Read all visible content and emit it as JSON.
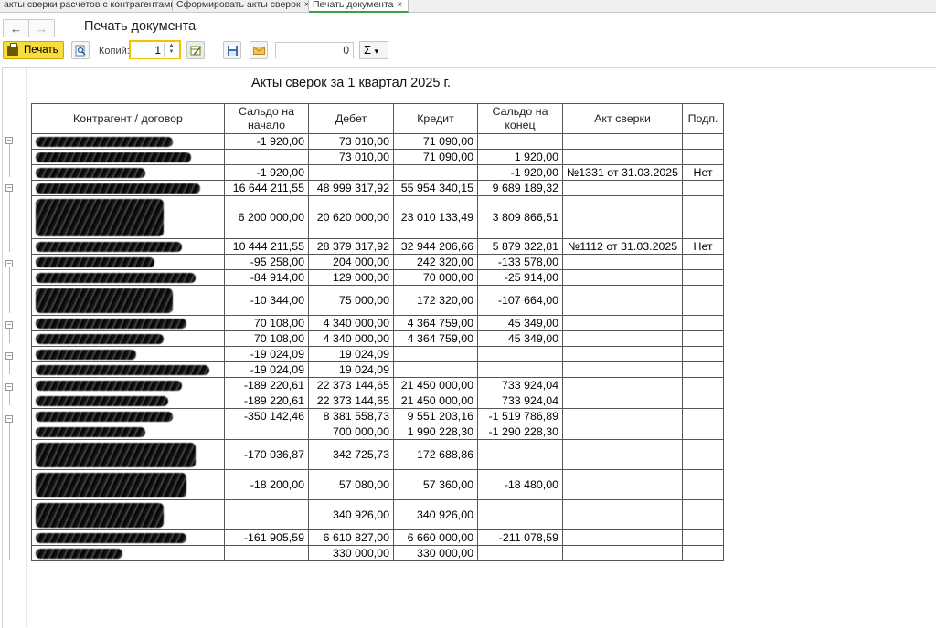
{
  "tabs": [
    {
      "label": "акты сверки расчетов с контрагентами",
      "close": "×"
    },
    {
      "label": "Сформировать акты сверок",
      "close": "×"
    },
    {
      "label": "Печать документа",
      "close": "×"
    }
  ],
  "header": {
    "back": "←",
    "forward": "→",
    "title": "Печать документа"
  },
  "toolbar": {
    "print_label": "Печать",
    "copies_label": "Копий:",
    "copies_value": "1",
    "sum_value": "0",
    "sum_symbol": "Σ",
    "dropdown": "▾"
  },
  "report": {
    "title": "Акты сверок за 1 квартал 2025 г.",
    "columns": [
      "Контрагент / договор",
      "Сальдо на начало",
      "Дебет",
      "Кредит",
      "Сальдо на конец",
      "Акт сверки",
      "Подп."
    ],
    "rows": [
      {
        "start": "-1 920,00",
        "debit": "73 010,00",
        "credit": "71 090,00",
        "end": "",
        "act": "",
        "signed": "",
        "h": 17
      },
      {
        "start": "",
        "debit": "73 010,00",
        "credit": "71 090,00",
        "end": "1 920,00",
        "act": "",
        "signed": "",
        "h": 17
      },
      {
        "start": "-1 920,00",
        "debit": "",
        "credit": "",
        "end": "-1 920,00",
        "act": "№1331 от 31.03.2025",
        "signed": "Нет",
        "h": 17
      },
      {
        "start": "16 644 211,55",
        "debit": "48 999 317,92",
        "credit": "55 954 340,15",
        "end": "9 689 189,32",
        "act": "",
        "signed": "",
        "h": 17
      },
      {
        "start": "6 200 000,00",
        "debit": "20 620 000,00",
        "credit": "23 010 133,49",
        "end": "3 809 866,51",
        "act": "",
        "signed": "",
        "h": 47
      },
      {
        "start": "10 444 211,55",
        "debit": "28 379 317,92",
        "credit": "32 944 206,66",
        "end": "5 879 322,81",
        "act": "№1112 от 31.03.2025",
        "signed": "Нет",
        "h": 17
      },
      {
        "start": "-95 258,00",
        "debit": "204 000,00",
        "credit": "242 320,00",
        "end": "-133 578,00",
        "act": "",
        "signed": "",
        "h": 17
      },
      {
        "start": "-84 914,00",
        "debit": "129 000,00",
        "credit": "70 000,00",
        "end": "-25 914,00",
        "act": "",
        "signed": "",
        "h": 17
      },
      {
        "start": "-10 344,00",
        "debit": "75 000,00",
        "credit": "172 320,00",
        "end": "-107 664,00",
        "act": "",
        "signed": "",
        "h": 33
      },
      {
        "start": "70 108,00",
        "debit": "4 340 000,00",
        "credit": "4 364 759,00",
        "end": "45 349,00",
        "act": "",
        "signed": "",
        "h": 17
      },
      {
        "start": "70 108,00",
        "debit": "4 340 000,00",
        "credit": "4 364 759,00",
        "end": "45 349,00",
        "act": "",
        "signed": "",
        "h": 17
      },
      {
        "start": "-19 024,09",
        "debit": "19 024,09",
        "credit": "",
        "end": "",
        "act": "",
        "signed": "",
        "h": 17
      },
      {
        "start": "-19 024,09",
        "debit": "19 024,09",
        "credit": "",
        "end": "",
        "act": "",
        "signed": "",
        "h": 17
      },
      {
        "start": "-189 220,61",
        "debit": "22 373 144,65",
        "credit": "21 450 000,00",
        "end": "733 924,04",
        "act": "",
        "signed": "",
        "h": 17
      },
      {
        "start": "-189 220,61",
        "debit": "22 373 144,65",
        "credit": "21 450 000,00",
        "end": "733 924,04",
        "act": "",
        "signed": "",
        "h": 17
      },
      {
        "start": "-350 142,46",
        "debit": "8 381 558,73",
        "credit": "9 551 203,16",
        "end": "-1 519 786,89",
        "act": "",
        "signed": "",
        "h": 17
      },
      {
        "start": "",
        "debit": "700 000,00",
        "credit": "1 990 228,30",
        "end": "-1 290 228,30",
        "act": "",
        "signed": "",
        "h": 17
      },
      {
        "start": "-170 036,87",
        "debit": "342 725,73",
        "credit": "172 688,86",
        "end": "",
        "act": "",
        "signed": "",
        "h": 33
      },
      {
        "start": "-18 200,00",
        "debit": "57 080,00",
        "credit": "57 360,00",
        "end": "-18 480,00",
        "act": "",
        "signed": "",
        "h": 33
      },
      {
        "start": "",
        "debit": "340 926,00",
        "credit": "340 926,00",
        "end": "",
        "act": "",
        "signed": "",
        "h": 33
      },
      {
        "start": "-161 905,59",
        "debit": "6 610 827,00",
        "credit": "6 660 000,00",
        "end": "-211 078,59",
        "act": "",
        "signed": "",
        "h": 17
      },
      {
        "start": "",
        "debit": "330 000,00",
        "credit": "330 000,00",
        "end": "",
        "act": "",
        "signed": "",
        "h": 17
      }
    ]
  },
  "colors": {
    "print_button": "#f6dc3d",
    "active_tab_underline": "#3aa14b",
    "copies_focus": "#f0c400"
  }
}
